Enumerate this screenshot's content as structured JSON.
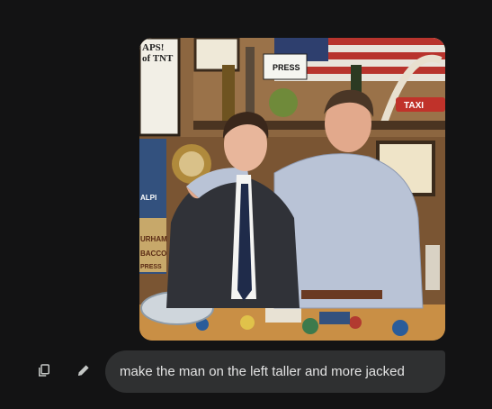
{
  "image": {
    "alt": "",
    "signs": {
      "press": "PRESS",
      "taxi": "TAXI",
      "framed_poster": "APS!\nof TNT",
      "poster_left": "ALPI",
      "poster_left_2": "URHAM",
      "poster_left_3": "BACCO",
      "poster_left_4": "PRESS"
    }
  },
  "actions": {
    "copy_icon": "copy-icon",
    "edit_icon": "pencil-icon"
  },
  "prompt": {
    "text": "make the man on the left taller and more jacked"
  },
  "colors": {
    "background": "#131314",
    "bubble": "#2f3031",
    "text": "#e3e3e3",
    "icon": "#c4c7c5"
  }
}
